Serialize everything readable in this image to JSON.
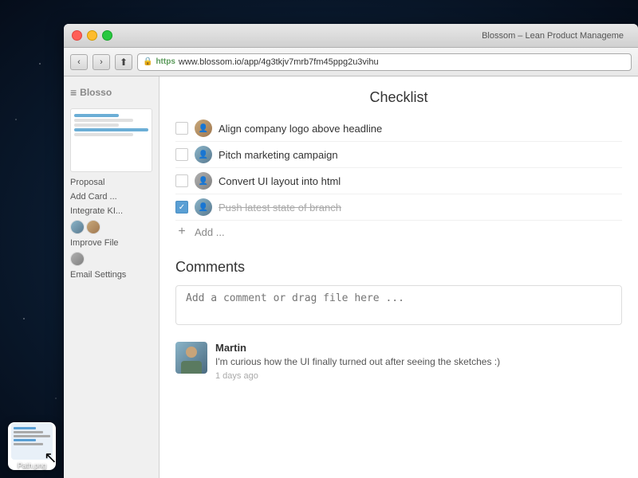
{
  "browser": {
    "title": "Blossom – Lean Product Manageme",
    "url": "www.blossom.io/app/4g3tkjv7mrb7fm45ppg2u3vihu",
    "protocol": "https",
    "back_btn": "‹",
    "forward_btn": "›"
  },
  "sidebar": {
    "logo": "Blosso",
    "sections": [
      {
        "label": "Proposal",
        "items": [
          "Add Card ...",
          "Integrate KI..."
        ]
      },
      {
        "label": "Improve File",
        "items": []
      },
      {
        "label": "Email Settings",
        "items": []
      }
    ]
  },
  "checklist": {
    "title": "Checklist",
    "items": [
      {
        "id": 1,
        "text": "Align company logo above headline",
        "done": false,
        "avatar": "1"
      },
      {
        "id": 2,
        "text": "Pitch marketing campaign",
        "done": false,
        "avatar": "2"
      },
      {
        "id": 3,
        "text": "Convert UI layout into html",
        "done": false,
        "avatar": "3"
      },
      {
        "id": 4,
        "text": "Push latest state of branch",
        "done": true,
        "avatar": "2"
      }
    ],
    "add_label": "Add ..."
  },
  "comments": {
    "title": "Comments",
    "input_placeholder": "Add a comment or drag file here ...",
    "items": [
      {
        "id": 1,
        "author": "Martin",
        "text": "I'm curious how the UI finally turned out after seeing the sketches :)",
        "time": "1 days ago"
      }
    ]
  },
  "taskbar": {
    "icon_label": "Path.png"
  },
  "icons": {
    "delete_x": "×",
    "add_plus": "+",
    "menu_lines": "≡",
    "lock": "🔒"
  }
}
